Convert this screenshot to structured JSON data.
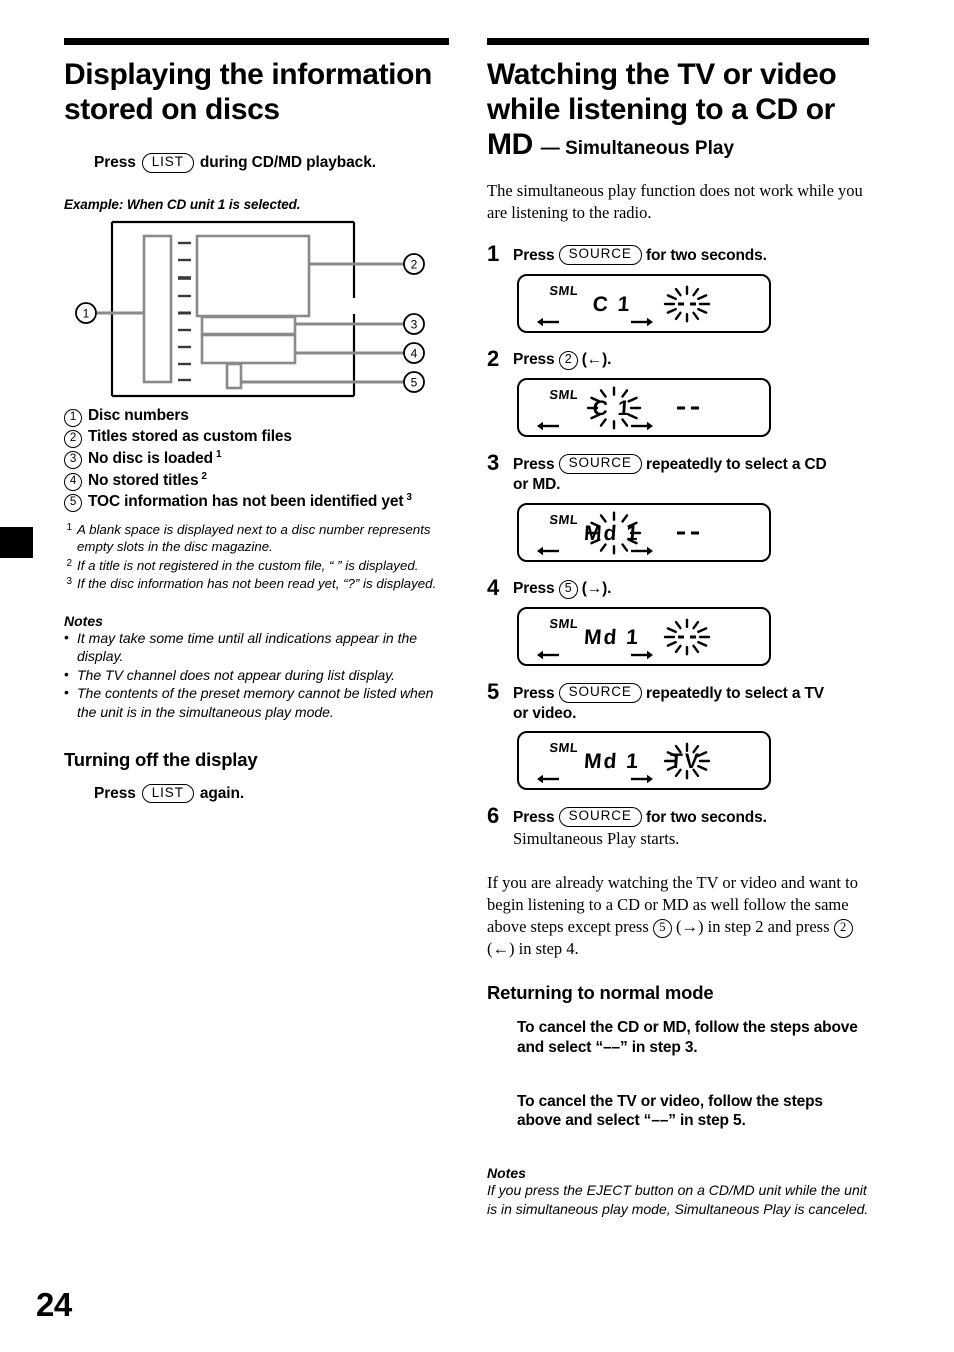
{
  "page": {
    "folio": "24",
    "tab_marker": "black-thumb-tab"
  },
  "left_column": {
    "title": "Displaying the information stored on discs",
    "press_instruction": {
      "prefix": "Press",
      "button": "LIST",
      "suffix": "during CD/MD playback."
    },
    "example_caption": "Example: When CD unit 1 is selected.",
    "diagram": {
      "callouts": [
        "1",
        "2",
        "3",
        "4",
        "5"
      ]
    },
    "legend": [
      {
        "num": "1",
        "text": "Disc numbers",
        "sup": ""
      },
      {
        "num": "2",
        "text": "Titles stored as custom files",
        "sup": ""
      },
      {
        "num": "3",
        "text": "No disc is loaded",
        "sup": "1"
      },
      {
        "num": "4",
        "text": "No stored titles",
        "sup": "2"
      },
      {
        "num": "5",
        "text": "TOC information has not been identified yet",
        "sup": "3"
      }
    ],
    "footnotes": [
      {
        "mark": "1",
        "text": "A blank space is displayed next to a disc number represents empty slots in the disc magazine."
      },
      {
        "mark": "2",
        "text": "If a title is not registered in the custom file, “            ” is displayed."
      },
      {
        "mark": "3",
        "text": "If the disc information has not been read yet, “?” is displayed."
      }
    ],
    "notes_heading": "Notes",
    "notes": [
      "It may take some time until all indications appear in the display.",
      "The TV channel does not appear during list display.",
      "The contents of the preset memory cannot be listed when the unit is in the simultaneous play mode."
    ],
    "turning_off": {
      "heading": "Turning off the display",
      "prefix": "Press",
      "button": "LIST",
      "suffix": "again."
    }
  },
  "right_column": {
    "title_main": "Watching the TV or video while listening to a CD or MD",
    "title_sub": "— Simultaneous Play",
    "intro": "The simultaneous play function does not work while you are listening to the radio.",
    "steps": [
      {
        "num": "1",
        "prefix": "Press",
        "button": "SOURCE",
        "suffix": "for two seconds.",
        "suffix2": "",
        "sub": "",
        "lcd": {
          "mode": "SML",
          "main": "C 1",
          "main_blink": false,
          "right": "",
          "right_blink": true,
          "dashes": false,
          "left_arrow": true,
          "right_arrow": true
        }
      },
      {
        "num": "2",
        "prefix": "Press",
        "button_circle": "2",
        "suffix": "(←).",
        "suffix2": "",
        "sub": "",
        "lcd": {
          "mode": "SML",
          "main": "C 1",
          "main_blink": true,
          "right": "",
          "right_blink": false,
          "dashes": true,
          "left_arrow": true,
          "right_arrow": true
        }
      },
      {
        "num": "3",
        "prefix": "Press",
        "button": "SOURCE",
        "suffix": "repeatedly to select a CD",
        "suffix2": "or MD.",
        "sub": "",
        "lcd": {
          "mode": "SML",
          "main": "Md 1",
          "main_blink": true,
          "right": "",
          "right_blink": false,
          "dashes": true,
          "left_arrow": true,
          "right_arrow": true
        }
      },
      {
        "num": "4",
        "prefix": "Press",
        "button_circle": "5",
        "suffix": "(→).",
        "suffix2": "",
        "sub": "",
        "lcd": {
          "mode": "SML",
          "main": "Md 1",
          "main_blink": false,
          "right": "",
          "right_blink": true,
          "dashes": false,
          "left_arrow": true,
          "right_arrow": true
        }
      },
      {
        "num": "5",
        "prefix": "Press",
        "button": "SOURCE",
        "suffix": "repeatedly to select a TV",
        "suffix2": "or video.",
        "sub": "",
        "lcd": {
          "mode": "SML",
          "main": "Md 1",
          "main_blink": false,
          "right": "TV",
          "right_blink": true,
          "dashes": false,
          "left_arrow": true,
          "right_arrow": true
        }
      },
      {
        "num": "6",
        "prefix": "Press",
        "button": "SOURCE",
        "suffix": "for two seconds.",
        "suffix2": "",
        "sub": "Simultaneous Play starts.",
        "lcd": null
      }
    ],
    "after_steps_paragraph": {
      "part1": "If you are already watching the TV or video and want to begin listening to a CD or MD as well follow the same above steps except press",
      "btn1": "5",
      "mid1": "(→) in step 2 and press",
      "btn2": "2",
      "mid2": "(←) in step 4."
    },
    "returning": {
      "heading": "Returning to normal mode",
      "items": [
        "To cancel the CD or MD, follow the steps above and select “––” in step 3.",
        "To cancel the TV or video, follow the steps above and select “––” in step 5."
      ]
    },
    "notes_heading": "Notes",
    "notes_text": "If you press the EJECT button on a CD/MD unit while the unit is in simultaneous play mode, Simultaneous Play is canceled."
  },
  "colors": {
    "ink": "#000000",
    "paper": "#ffffff",
    "diagram_gray": "#8a8a8a"
  }
}
